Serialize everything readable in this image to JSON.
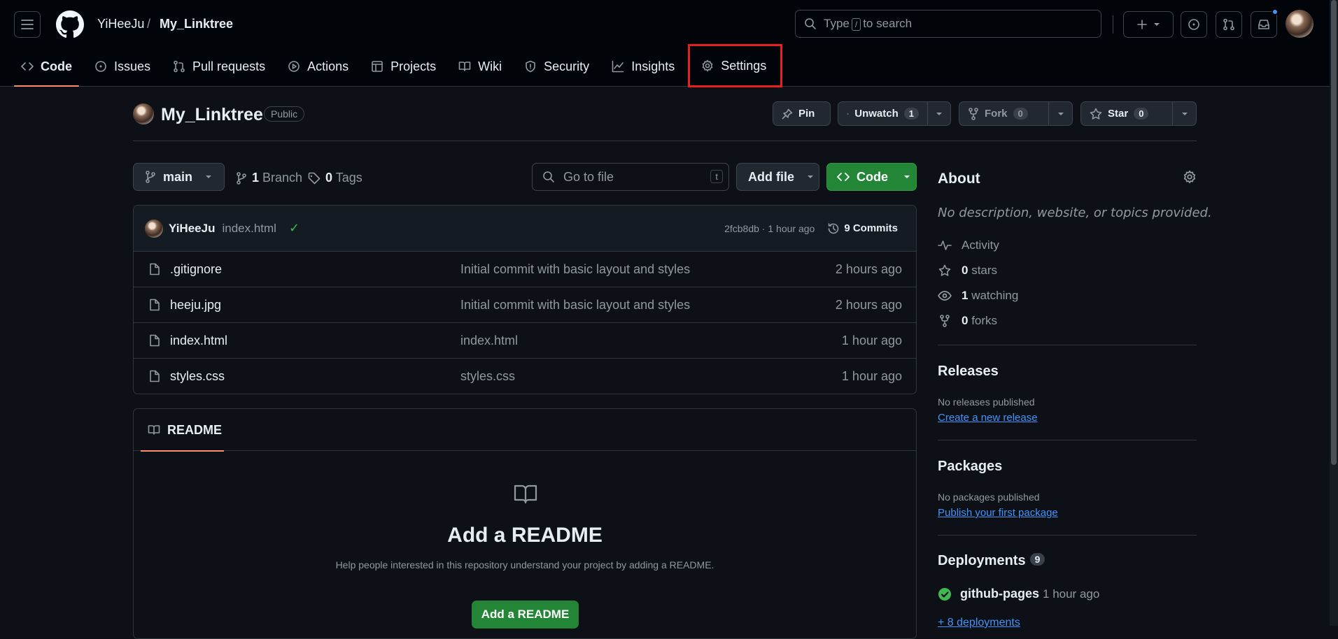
{
  "header": {
    "owner": "YiHeeJu",
    "separator": "/",
    "repo": "My_Linktree",
    "search_prefix": "Type",
    "search_key": "/",
    "search_suffix": "to search"
  },
  "tabs": [
    {
      "label": "Code",
      "icon": "code-icon"
    },
    {
      "label": "Issues",
      "icon": "issue-icon"
    },
    {
      "label": "Pull requests",
      "icon": "pull-request-icon"
    },
    {
      "label": "Actions",
      "icon": "play-icon"
    },
    {
      "label": "Projects",
      "icon": "table-icon"
    },
    {
      "label": "Wiki",
      "icon": "book-icon"
    },
    {
      "label": "Security",
      "icon": "shield-icon"
    },
    {
      "label": "Insights",
      "icon": "graph-icon"
    },
    {
      "label": "Settings",
      "icon": "gear-icon"
    }
  ],
  "repo": {
    "title": "My_Linktree",
    "visibility": "Public",
    "pin_label": "Pin",
    "unwatch_label": "Unwatch",
    "watch_count": "1",
    "fork_label": "Fork",
    "fork_count": "0",
    "star_label": "Star",
    "star_count": "0"
  },
  "branch": {
    "name": "main",
    "branch_count": "1",
    "branch_label": "Branch",
    "tag_count": "0",
    "tag_label": "Tags",
    "goto_placeholder": "Go to file",
    "goto_key": "t",
    "add_file_label": "Add file",
    "code_label": "Code"
  },
  "commit": {
    "author": "YiHeeJu",
    "message": "index.html",
    "hash_time": "2fcb8db · 1 hour ago",
    "commits_label": "9 Commits"
  },
  "files": [
    {
      "name": ".gitignore",
      "message": "Initial commit with basic layout and styles",
      "age": "2 hours ago"
    },
    {
      "name": "heeju.jpg",
      "message": "Initial commit with basic layout and styles",
      "age": "2 hours ago"
    },
    {
      "name": "index.html",
      "message": "index.html",
      "age": "1 hour ago"
    },
    {
      "name": "styles.css",
      "message": "styles.css",
      "age": "1 hour ago"
    }
  ],
  "readme": {
    "tab_label": "README",
    "heading": "Add a README",
    "description": "Help people interested in this repository understand your project by adding a README.",
    "button_label": "Add a README"
  },
  "sidebar": {
    "about_title": "About",
    "about_description": "No description, website, or topics provided.",
    "activity_label": "Activity",
    "stars_count": "0",
    "stars_label": "stars",
    "watching_count": "1",
    "watching_label": "watching",
    "forks_count": "0",
    "forks_label": "forks",
    "releases_title": "Releases",
    "releases_empty": "No releases published",
    "releases_link": "Create a new release",
    "packages_title": "Packages",
    "packages_empty": "No packages published",
    "packages_link": "Publish your first package",
    "deployments_title": "Deployments",
    "deployments_count": "9",
    "deployment_name": "github-pages",
    "deployment_time": "1 hour ago",
    "more_deployments": "+ 8 deployments"
  },
  "colors": {
    "background": "#0d1117",
    "header_background": "#010409",
    "accent_tab_underline": "#fd8c73",
    "primary_button": "#238636",
    "link": "#4493f8",
    "settings_highlight": "#e5201d"
  }
}
